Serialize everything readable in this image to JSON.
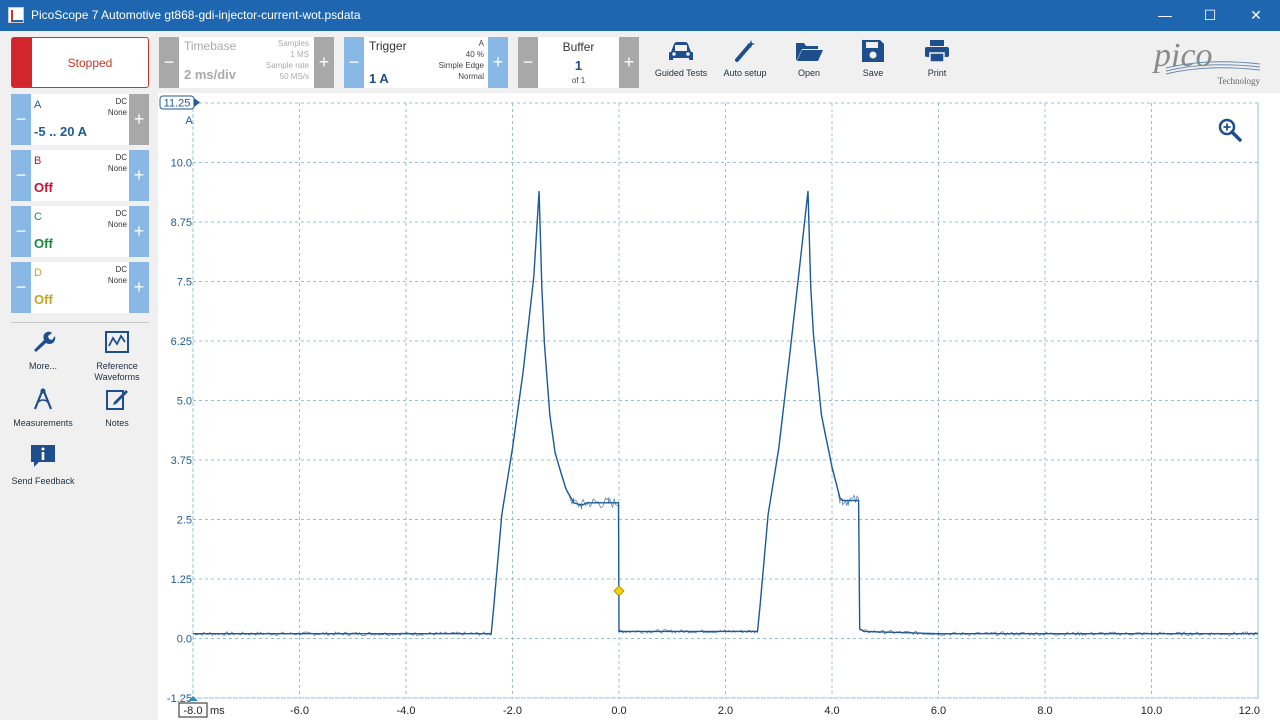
{
  "window": {
    "title": "PicoScope 7 Automotive gt868-gdi-injector-current-wot.psdata",
    "minimize": "—",
    "maximize": "☐",
    "close": "✕"
  },
  "run": {
    "label": "Stopped",
    "color": "#d3262c"
  },
  "timebase": {
    "label": "Timebase",
    "value": "2 ms/div",
    "samples_label": "Samples",
    "samples": "1 MS",
    "rate_label": "Sample rate",
    "rate": "50 MS/s"
  },
  "trigger": {
    "label": "Trigger",
    "value": "1 A",
    "channel": "A",
    "pre": "40 %",
    "type": "Simple Edge",
    "mode": "Normal"
  },
  "buffer": {
    "label": "Buffer",
    "value": "1",
    "of": "of 1"
  },
  "tools": [
    {
      "label": "Guided Tests",
      "icon": "car-icon"
    },
    {
      "label": "Auto setup",
      "icon": "wand-icon"
    },
    {
      "label": "Open",
      "icon": "folder-icon"
    },
    {
      "label": "Save",
      "icon": "save-icon"
    },
    {
      "label": "Print",
      "icon": "printer-icon"
    }
  ],
  "logo": {
    "brand": "pico",
    "sub": "Technology"
  },
  "channels": [
    {
      "name": "A",
      "coupling": "DC",
      "probe": "None",
      "range": "-5 .. 20 A",
      "color": "#1e5a96"
    },
    {
      "name": "B",
      "coupling": "DC",
      "probe": "None",
      "range": "Off",
      "color": "#c8102e"
    },
    {
      "name": "C",
      "coupling": "DC",
      "probe": "None",
      "range": "Off",
      "color": "#1a8a3a"
    },
    {
      "name": "D",
      "coupling": "DC",
      "probe": "None",
      "range": "Off",
      "color": "#c9a227"
    }
  ],
  "side_tools": [
    {
      "label": "More...",
      "icon": "wrench-icon"
    },
    {
      "label": "Reference Waveforms",
      "icon": "reference-waveform-icon"
    },
    {
      "label": "Measurements",
      "icon": "measurements-icon"
    },
    {
      "label": "Notes",
      "icon": "notes-icon"
    },
    {
      "label": "Send Feedback",
      "icon": "feedback-icon"
    }
  ],
  "chart_data": {
    "type": "line",
    "x_unit": "ms",
    "y_unit": "A",
    "xlim": [
      -8.0,
      12.0
    ],
    "ylim": [
      -1.25,
      11.25
    ],
    "x_ticks": [
      "-8.0",
      "-6.0",
      "-4.0",
      "-2.0",
      "0.0",
      "2.0",
      "4.0",
      "6.0",
      "8.0",
      "10.0",
      "12.0"
    ],
    "y_ticks": [
      "10.0",
      "8.75",
      "7.5",
      "6.25",
      "5.0",
      "3.75",
      "2.5",
      "1.25",
      "0.0",
      "-1.25"
    ],
    "y_top_label": "11.25",
    "grid": true,
    "trigger_point": {
      "x": 0.0,
      "y": 1.0
    },
    "series": [
      {
        "name": "A",
        "color": "#1e5a96",
        "x": [
          -8.0,
          -4.0,
          -2.4,
          -2.35,
          -2.2,
          -2.0,
          -1.8,
          -1.6,
          -1.5,
          -1.45,
          -1.4,
          -1.3,
          -1.2,
          -1.0,
          -0.85,
          -0.7,
          -0.6,
          -0.4,
          -0.2,
          -0.01,
          0.0,
          0.05,
          1.0,
          2.6,
          2.65,
          2.8,
          3.0,
          3.2,
          3.4,
          3.55,
          3.6,
          3.65,
          3.8,
          4.0,
          4.15,
          4.2,
          4.3,
          4.5,
          4.52,
          4.6,
          6.0,
          8.0,
          10.0,
          12.0
        ],
        "y": [
          0.1,
          0.1,
          0.1,
          0.7,
          2.6,
          4.0,
          5.6,
          7.6,
          9.4,
          7.4,
          6.2,
          4.7,
          3.9,
          3.15,
          2.85,
          2.8,
          2.85,
          2.85,
          2.85,
          2.85,
          0.15,
          0.15,
          0.15,
          0.15,
          0.7,
          2.6,
          4.0,
          5.9,
          7.9,
          9.4,
          7.4,
          6.4,
          4.7,
          3.6,
          2.95,
          2.9,
          2.9,
          2.9,
          0.2,
          0.15,
          0.1,
          0.1,
          0.1,
          0.1
        ]
      }
    ]
  }
}
